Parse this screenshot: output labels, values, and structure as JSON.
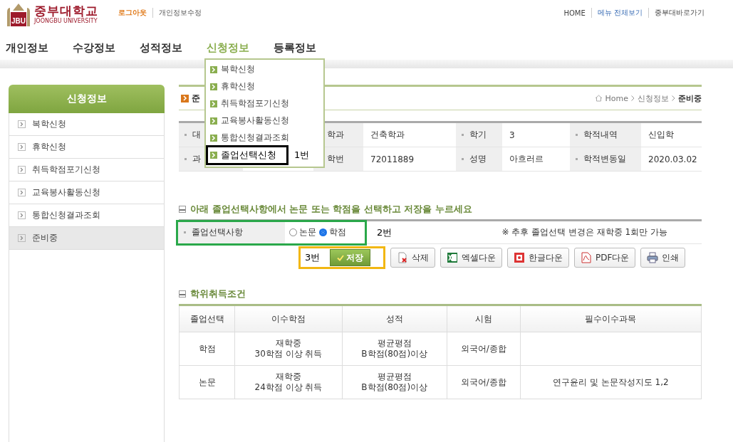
{
  "header": {
    "logo": {
      "emblem": "JBU",
      "name": "중부대학교",
      "subtitle": "JOONGBU UNIVERSITY"
    },
    "user_links": [
      "로그아웃",
      "개인정보수정"
    ],
    "top_links": [
      {
        "label": "HOME",
        "highlight": false
      },
      {
        "label": "메뉴 전체보기",
        "highlight": true
      },
      {
        "label": "중부대바로가기",
        "highlight": false
      }
    ]
  },
  "nav": [
    {
      "label": "개인정보",
      "selected": false
    },
    {
      "label": "수강정보",
      "selected": false
    },
    {
      "label": "성적정보",
      "selected": false
    },
    {
      "label": "신청정보",
      "selected": true
    },
    {
      "label": "등록정보",
      "selected": false
    }
  ],
  "nav_dropdown": {
    "note": "1번",
    "items": [
      {
        "label": "복학신청",
        "marked": false
      },
      {
        "label": "휴학신청",
        "marked": false
      },
      {
        "label": "취득학점포기신청",
        "marked": false
      },
      {
        "label": "교육봉사활동신청",
        "marked": false
      },
      {
        "label": "통합신청결과조회",
        "marked": false
      },
      {
        "label": "졸업선택신청",
        "marked": true
      }
    ]
  },
  "sidebar": {
    "title": "신청정보",
    "items": [
      {
        "label": "복학신청",
        "selected": false
      },
      {
        "label": "휴학신청",
        "selected": false
      },
      {
        "label": "취득학점포기신청",
        "selected": false
      },
      {
        "label": "교육봉사활동신청",
        "selected": false
      },
      {
        "label": "통합신청결과조회",
        "selected": false
      },
      {
        "label": "준비중",
        "selected": true
      }
    ]
  },
  "page": {
    "title": "준",
    "breadcrumb": [
      "Home",
      "신청정보",
      "준비중"
    ]
  },
  "info_table": {
    "rows": [
      [
        {
          "label": "대"
        },
        {
          "label": "학과",
          "value": "건축학과"
        },
        {
          "label": "학기",
          "value": "3"
        },
        {
          "label": "학적내역",
          "value": "신입학"
        }
      ],
      [
        {
          "label": "과"
        },
        {
          "label": "학번",
          "value": "72011889"
        },
        {
          "label": "성명",
          "value": "아흐러르"
        },
        {
          "label": "학적변동일",
          "value": "2020.03.02"
        }
      ]
    ]
  },
  "selection": {
    "heading": "아래 졸업선택사항에서 논문 또는 학점을 선택하고 저장을 누르세요",
    "row_label": "졸업선택사항",
    "options": [
      {
        "label": "논문",
        "selected": false
      },
      {
        "label": "학점",
        "selected": true
      }
    ],
    "note": "2번",
    "notice": "※ 추후 졸업선택 변경은 재학중 1회만 가능"
  },
  "actions": {
    "note": "3번",
    "buttons": [
      {
        "label": "저장",
        "kind": "save"
      },
      {
        "label": "삭제",
        "kind": "delete"
      },
      {
        "label": "엑셀다운",
        "kind": "excel"
      },
      {
        "label": "한글다운",
        "kind": "hwp"
      },
      {
        "label": "PDF다운",
        "kind": "pdf"
      },
      {
        "label": "인쇄",
        "kind": "print"
      }
    ]
  },
  "requirements": {
    "heading": "학위취득조건",
    "columns": [
      "졸업선택",
      "이수학점",
      "성적",
      "시험",
      "필수이수과목"
    ],
    "rows": [
      [
        "학점",
        "재학중\n30학점 이상 취득",
        "평균평점\nB학점(80점)이상",
        "외국어/종합"
      ],
      [
        "논문",
        "재학중\n24학점 이상 취득",
        "평균평점\nB학점(80점)이상",
        "외국어/종합",
        "연구윤리 및 논문작성지도 1,2"
      ]
    ]
  }
}
